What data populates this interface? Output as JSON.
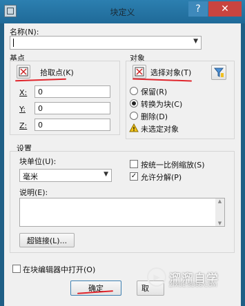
{
  "window": {
    "title": "块定义",
    "help_label": "?",
    "close_label": "✕"
  },
  "name_section": {
    "label": "名称(N):",
    "value": ""
  },
  "base_point": {
    "group_label": "基点",
    "pick_button_label": "拾取点(K)",
    "x_label": "X:",
    "x_value": "0",
    "y_label": "Y:",
    "y_value": "0",
    "z_label": "Z:",
    "z_value": "0"
  },
  "objects": {
    "group_label": "对象",
    "select_button_label": "选择对象(T)",
    "retain_label": "保留(R)",
    "convert_label": "转换为块(C)",
    "delete_label": "删除(D)",
    "selected_option": "convert",
    "warning_text": "未选定对象"
  },
  "settings": {
    "group_label": "设置",
    "block_unit_label": "块单位(U):",
    "block_unit_value": "毫米",
    "uniform_scale_label": "按统一比例缩放(S)",
    "uniform_scale_checked": false,
    "allow_explode_label": "允许分解(P)",
    "allow_explode_checked": true,
    "description_label": "说明(E):",
    "description_value": "",
    "hyperlink_button_label": "超链接(L)..."
  },
  "open_in_editor": {
    "label": "在块编辑器中打开(O)",
    "checked": false
  },
  "footer": {
    "ok_label": "确定",
    "cancel_label": "取"
  },
  "watermark": {
    "text": "溜溜自学",
    "url": "ZIXUE.3D66.COM"
  },
  "colors": {
    "annotation_red": "#e0242b",
    "title_bar": "#2c7fb0",
    "close_button": "#c9443f"
  }
}
